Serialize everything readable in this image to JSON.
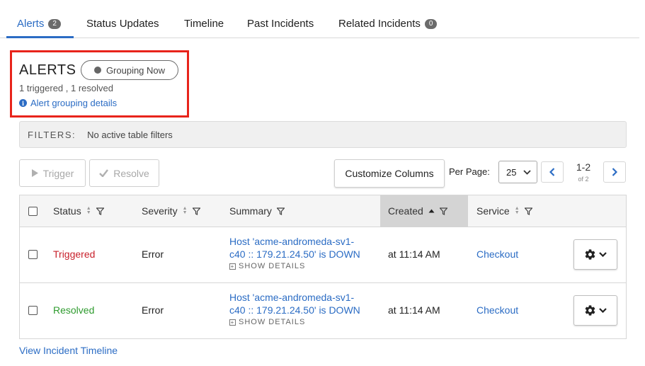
{
  "tabs": [
    {
      "label": "Alerts",
      "badge": "2",
      "active": true
    },
    {
      "label": "Status Updates"
    },
    {
      "label": "Timeline"
    },
    {
      "label": "Past Incidents"
    },
    {
      "label": "Related Incidents",
      "badge": "0"
    }
  ],
  "alerts_header": {
    "title": "ALERTS",
    "grouping_label": "Grouping Now",
    "counts": "1 triggered , 1 resolved",
    "details_link": "Alert grouping details"
  },
  "filters": {
    "label": "FILTERS:",
    "value": "No active table filters"
  },
  "toolbar": {
    "trigger_label": "Trigger",
    "resolve_label": "Resolve",
    "customize_label": "Customize Columns",
    "per_page_label": "Per Page:",
    "per_page_value": "25",
    "page_range": "1-2",
    "page_of": "of 2"
  },
  "table": {
    "columns": [
      "Status",
      "Severity",
      "Summary",
      "Created",
      "Service"
    ],
    "sorted_column": "Created",
    "rows": [
      {
        "status": "Triggered",
        "severity": "Error",
        "summary_line1": "Host 'acme-andromeda-sv1-",
        "summary_line2": "c40 :: 179.21.24.50' is DOWN",
        "show_details": "SHOW DETAILS",
        "created": "at 11:14 AM",
        "service": "Checkout"
      },
      {
        "status": "Resolved",
        "severity": "Error",
        "summary_line1": "Host 'acme-andromeda-sv1-",
        "summary_line2": "c40 :: 179.21.24.50' is DOWN",
        "show_details": "SHOW DETAILS",
        "created": "at 11:14 AM",
        "service": "Checkout"
      }
    ]
  },
  "footer": {
    "view_timeline": "View Incident Timeline"
  },
  "colors": {
    "accent": "#2b6cc4",
    "triggered": "#c8202b",
    "resolved": "#2e9b2e",
    "highlight": "#e8241b"
  }
}
